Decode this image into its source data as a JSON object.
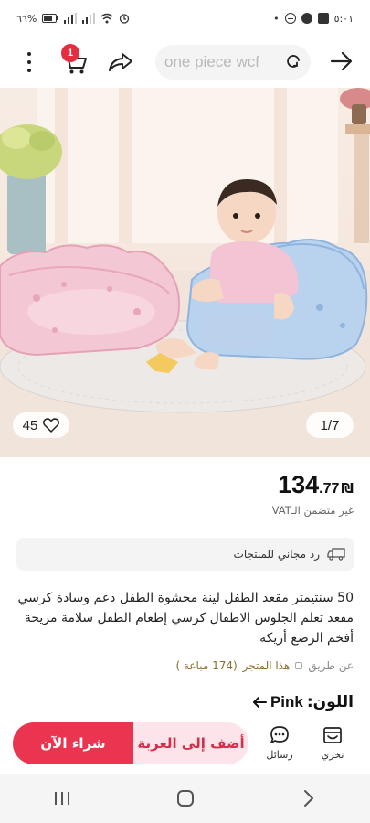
{
  "status_bar": {
    "time": "٥:٠١",
    "battery": "٦٦%"
  },
  "header": {
    "search_text": "one piece wcf",
    "cart_count": "1"
  },
  "gallery": {
    "counter": "1/7",
    "likes": "45"
  },
  "price": {
    "main": "134",
    "decimal": ".77",
    "currency": "₪",
    "vat_note": "غير متضمن الـVAT"
  },
  "return_note": "رد مجاني للمنتجات",
  "product_title": "50 سنتيمتر مقعد الطفل لينة محشوة الطفل دعم وسادة كرسي مقعد تعلم الجلوس الاطفال كرسي إطعام الطفل سلامة مريحة أفخم الرضع أريكة",
  "store": {
    "via": "عن طريق",
    "store_name": "هذا المتجر",
    "sold": "(174 مباعة )"
  },
  "color": {
    "label": "اللون:",
    "value": "Pink"
  },
  "actions": {
    "store": "تخزي",
    "chat": "رسائل",
    "add_to_cart": "أضف إلى العربة",
    "buy_now": "شراء الآن"
  },
  "colors": {
    "accent": "#eb3450",
    "accent_light": "#fde4ea",
    "badge": "#e52d40"
  }
}
